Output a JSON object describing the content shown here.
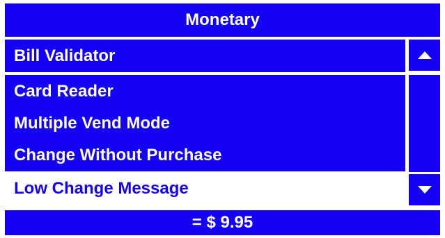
{
  "header": {
    "title": "Monetary"
  },
  "menu": {
    "items": [
      {
        "label": "Bill Validator"
      },
      {
        "label": "Card Reader"
      },
      {
        "label": "Multiple Vend Mode"
      },
      {
        "label": "Change Without Purchase"
      },
      {
        "label": "Low Change Message"
      }
    ],
    "selected_index": 4
  },
  "scrollbar": {
    "up_icon": "triangle-up-icon",
    "down_icon": "triangle-down-icon"
  },
  "footer": {
    "value": "= $ 9.95"
  },
  "colors": {
    "accent": "#1400f4",
    "text_on_accent": "#ffffff",
    "background": "#ffffff"
  }
}
